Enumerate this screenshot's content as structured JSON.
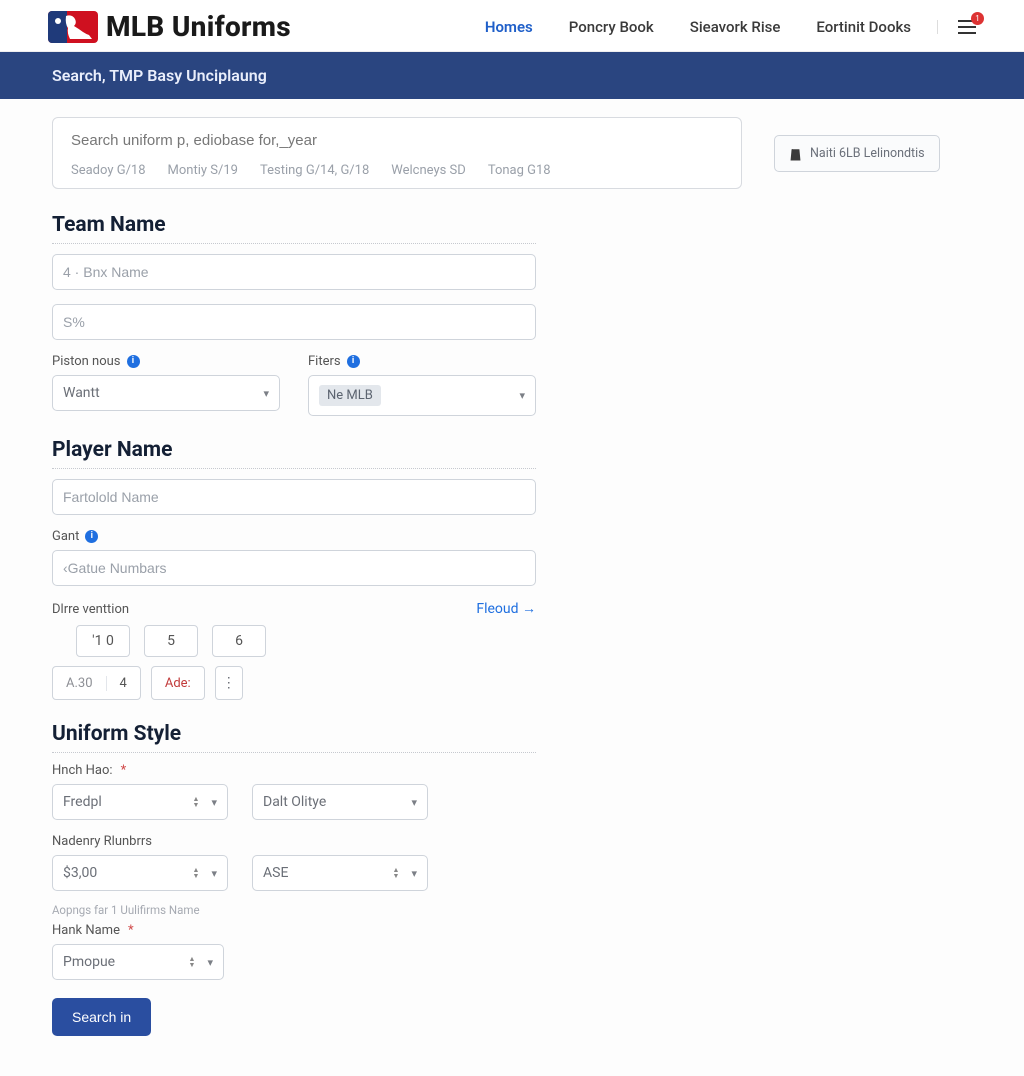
{
  "brand": {
    "title": "MLB Uniforms"
  },
  "nav": {
    "items": [
      {
        "label": "Homes",
        "active": true
      },
      {
        "label": "Poncry Book",
        "active": false
      },
      {
        "label": "Sieavork Rise",
        "active": false
      },
      {
        "label": "Eortinit Dooks",
        "active": false
      }
    ],
    "notif_count": "1"
  },
  "banner": {
    "title": "Search, TMP Basy Unciplaung"
  },
  "search": {
    "placeholder": "Search uniform p, ediobase for,_year",
    "chips": [
      "Seadoy G/18",
      "Montiy S/19",
      "Testing G/14, G/18",
      "Welcneys SD",
      "Tonag G18"
    ]
  },
  "side_action": {
    "label": "Naiti 6LB Lelinondtis"
  },
  "team": {
    "heading": "Team Name",
    "name_placeholder": "4 · Bnx Name",
    "abbr_placeholder": "S%",
    "piston_label": "Piston nous",
    "piston_value": "Wantt",
    "filters_label": "Fiters",
    "filters_tag": "Ne MLB"
  },
  "player": {
    "heading": "Player Name",
    "name_placeholder": "Fartolold Name",
    "gant_label": "Gant",
    "gant_placeholder": "‹Gatue Numbars",
    "date_label": "Dlrre venttion",
    "date_link": "Fleoud →",
    "date_parts": [
      "'1   0",
      "5",
      "6"
    ],
    "seg_a30": "A.30",
    "seg_4": "4",
    "seg_ade": "Ade:"
  },
  "style": {
    "heading": "Uniform Style",
    "hnch_label": "Hnch Hao:",
    "hnch_value": "Fredpl",
    "olitye_value": "Dalt Olitye",
    "nadenry_label": "Nadenry Rlunbrrs",
    "nadenry_value": "$3,00",
    "ase_value": "ASE",
    "footnote": "Aopngs far 1 Uulifirms Name",
    "hank_label": "Hank Name",
    "hank_value": "Pmopue"
  },
  "actions": {
    "submit": "Search in"
  }
}
